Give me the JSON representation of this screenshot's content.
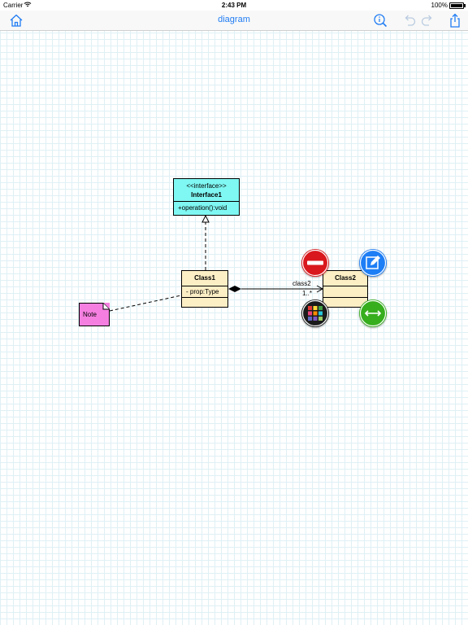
{
  "status_bar": {
    "carrier": "Carrier",
    "time": "2:43 PM",
    "battery": "100%"
  },
  "nav": {
    "title": "diagram",
    "left_icons": [
      "home-icon"
    ],
    "right_icons": [
      "search-info-icon",
      "undo-icon",
      "redo-icon",
      "share-icon"
    ],
    "accent_color": "#1f7cf3"
  },
  "diagram": {
    "interface": {
      "stereotype": "<<interface>>",
      "name": "Interface1",
      "operation": "+operation():void",
      "fill": "#7ff7f2"
    },
    "class1": {
      "name": "Class1",
      "attribute": "- prop:Type",
      "fill": "#fceec5"
    },
    "class2": {
      "name": "Class2",
      "fill": "#fceec5"
    },
    "note": {
      "text": "Note",
      "fill": "#f57fe0"
    },
    "association": {
      "role": "class2",
      "multiplicity": "1..*"
    }
  },
  "context_menu": {
    "delete": {
      "icon": "minus-icon",
      "color": "#d9181d"
    },
    "edit": {
      "icon": "edit-icon",
      "color": "#1e7ef5"
    },
    "color": {
      "icon": "palette-grid-icon",
      "color": "#1b1b1b"
    },
    "connect": {
      "icon": "double-arrow-icon",
      "color": "#37ae1e"
    }
  }
}
